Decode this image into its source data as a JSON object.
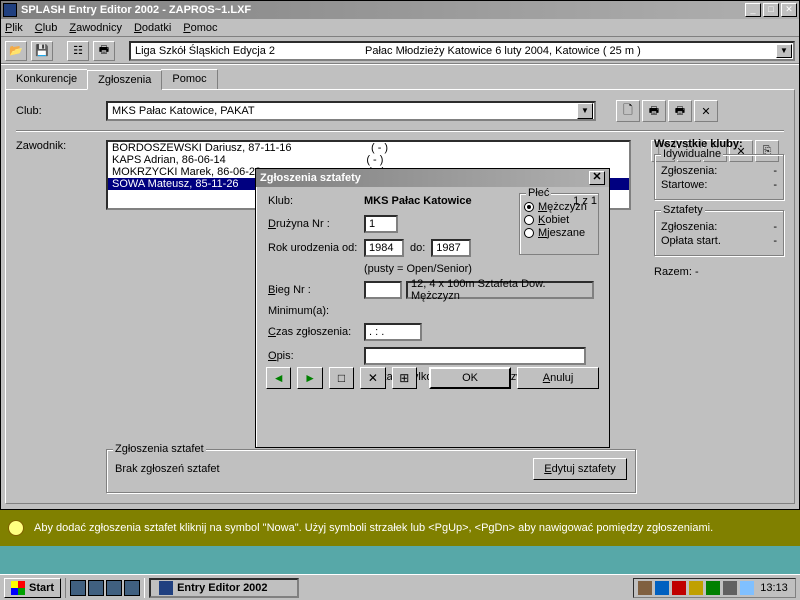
{
  "titlebar": {
    "text": "SPLASH Entry Editor 2002 - ZAPROS~1.LXF"
  },
  "menu": {
    "plik": "Plik",
    "club": "Club",
    "zawodnicy": "Zawodnicy",
    "dodatki": "Dodatki",
    "pomoc": "Pomoc"
  },
  "toolbar_combo": {
    "left_text": "Liga Szkół Śląskich Edycja 2",
    "right_text": "Pałac Młodzieży Katowice 6 luty 2004,  Katowice    ( 25 m )"
  },
  "tabs": {
    "konkurencje": "Konkurencje",
    "zgloszenia": "Zgłoszenia",
    "pomoc": "Pomoc"
  },
  "club_section": {
    "label": "Club:",
    "value": "MKS Pałac Katowice,  PAKAT"
  },
  "zawodnik": {
    "label": "Zawodnik:",
    "items": [
      "BORDOSZEWSKI Dariusz, 87-11-16                          ( - )",
      "KAPS Adrian, 86-06-14                                              ( - )",
      "MOKRZYCKI Marek, 86-06-28                                   ( - )",
      "SOWA Mateusz, 85-11-26                                          ( - )"
    ],
    "selected_index": 3
  },
  "rightpanel": {
    "heading": "Wszystkie kluby:",
    "groups": [
      {
        "label": "Idywidualne",
        "rows": [
          [
            "Zgłoszenia:",
            "-"
          ],
          [
            "Startowe:",
            "-"
          ]
        ]
      },
      {
        "label": "Sztafety",
        "rows": [
          [
            "Zgłoszenia:",
            "-"
          ],
          [
            "Opłata start.",
            "-"
          ]
        ]
      }
    ],
    "razem_label": "Razem:",
    "razem_val": "-"
  },
  "bottom_group": {
    "label": "Zgłoszenia sztafet",
    "text": "Brak zgłoszeń sztafet",
    "btn": "Edytuj sztafety"
  },
  "dialog": {
    "title": "Zgłoszenia sztafety",
    "klub_label": "Klub:",
    "klub_value": "MKS Pałac Katowice",
    "count": "1 z 1",
    "druzyna_label": "Drużyna Nr :",
    "druzyna_val": "1",
    "rok_label": "Rok urodzenia od:",
    "rok_from": "1984",
    "rok_to_label": "do:",
    "rok_to": "1987",
    "rok_note": "(pusty = Open/Senior)",
    "plec_label": "Płeć",
    "plec_opts": [
      "Mężczyzn",
      "Kobiet",
      "Mjeszane"
    ],
    "plec_sel": 0,
    "bieg_label": "Bieg Nr :",
    "bieg_num": "",
    "bieg_desc": "12, 4 x 100m Sztafeta Dow. Mężczyzn",
    "min_label": "Minimum(a):",
    "czas_label": "Czas zgłoszenia:",
    "czas_val": ".  :    .",
    "opis_label": "Opis:",
    "opis_val": "",
    "opis_note": "(wskazuj tylko jeśli inna niż nazwa klubu)",
    "ok": "OK",
    "cancel": "Anuluj"
  },
  "hint": "Aby dodać zgłoszenia sztafet kliknij na symbol \"Nowa\". Użyj symboli strzałek lub <PgUp>, <PgDn> aby nawigować pomiędzy zgłoszeniami.",
  "taskbar": {
    "start": "Start",
    "task": "Entry Editor 2002",
    "clock": "13:13"
  }
}
